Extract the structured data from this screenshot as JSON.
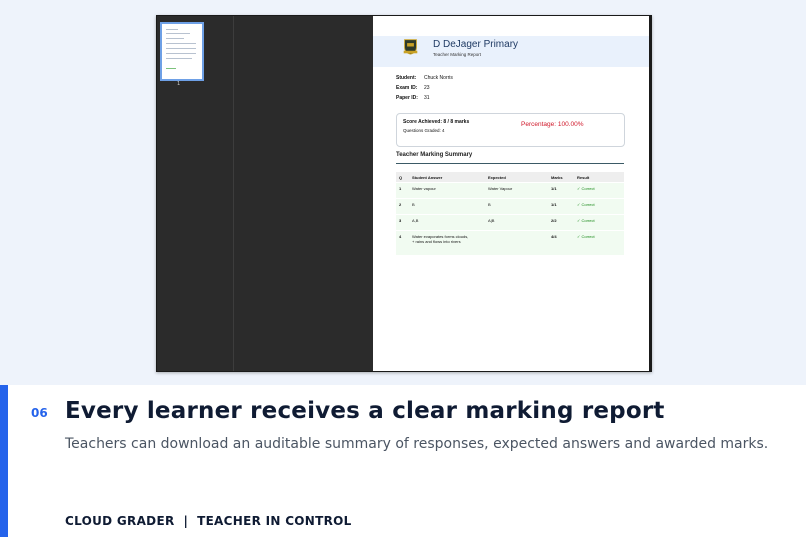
{
  "viewer": {
    "thumbnail_page_number": "1"
  },
  "report": {
    "school_name": "D DeJager Primary",
    "subtitle": "Teacher Marking Report",
    "student_label": "Student:",
    "student_value": "Chuck Norris",
    "exam_label": "Exam ID:",
    "exam_value": "23",
    "paper_label": "Paper ID:",
    "paper_value": "31",
    "score_achieved": "Score Achieved: 8 / 8 marks",
    "questions_graded": "Questions Graded: 4",
    "percentage": "Percentage: 100.00%",
    "summary_title": "Teacher Marking Summary",
    "columns": [
      "Q",
      "Student Answer",
      "Expected",
      "Marks",
      "Result"
    ],
    "rows": [
      {
        "q": "1",
        "answer": "Water vapour",
        "expected": "Water Vapour",
        "marks": "1/1",
        "result": "✓ Correct"
      },
      {
        "q": "2",
        "answer": "B",
        "expected": "B",
        "marks": "1/1",
        "result": "✓ Correct"
      },
      {
        "q": "3",
        "answer": "A,B",
        "expected": "A|B",
        "marks": "2/2",
        "result": "✓ Correct"
      },
      {
        "q": "4",
        "answer": "Water evaporates forms clouds,",
        "answer_2": "+ rains and flows into rivers",
        "expected": "",
        "marks": "4/4",
        "result": "✓ Correct"
      }
    ]
  },
  "slide": {
    "number": "06",
    "headline": "Every learner receives a clear marking report",
    "subline": "Teachers can download an auditable summary of responses, expected answers and awarded marks.",
    "footer": "CLOUD GRADER  |  TEACHER IN CONTROL"
  },
  "colors": {
    "accent": "#2563eb",
    "percentage": "#d0192b",
    "correct": "#1a8a1a"
  }
}
